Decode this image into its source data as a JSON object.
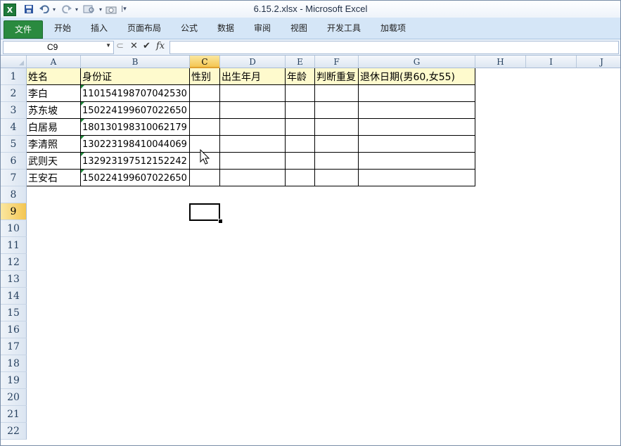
{
  "window_title": "6.15.2.xlsx  -  Microsoft Excel",
  "app_icon_letter": "X",
  "ribbon_tabs": [
    "文件",
    "开始",
    "插入",
    "页面布局",
    "公式",
    "数据",
    "审阅",
    "视图",
    "开发工具",
    "加载项"
  ],
  "name_box": "C9",
  "formula_icons": {
    "cancel": "✕",
    "enter": "✔",
    "fx": "fx"
  },
  "formula_value": "",
  "columns": [
    "A",
    "B",
    "C",
    "D",
    "E",
    "F",
    "G",
    "H",
    "I",
    "J"
  ],
  "rows": [
    "1",
    "2",
    "3",
    "4",
    "5",
    "6",
    "7",
    "8",
    "9",
    "10",
    "11",
    "12",
    "13",
    "14",
    "15",
    "16",
    "17",
    "18",
    "19",
    "20",
    "21",
    "22"
  ],
  "selected_column": "C",
  "selected_row": "9",
  "header_row": [
    "姓名",
    "身份证",
    "性别",
    "出生年月",
    "年龄",
    "判断重复",
    "退休日期(男60,女55)"
  ],
  "data_rows": [
    [
      "李白",
      "110154198707042530"
    ],
    [
      "苏东坡",
      "150224199607022650"
    ],
    [
      "白居易",
      "180130198310062179"
    ],
    [
      "李清照",
      "130223198410044069"
    ],
    [
      "武则天",
      "132923197512152242"
    ],
    [
      "王安石",
      "150224199607022650"
    ]
  ],
  "colors": {
    "header_fill": "#fefacd",
    "file_tab": "#2a8a3f",
    "tab_bar": "#d5e6f7",
    "selected_header": "#f4c652"
  },
  "icons": [
    "excel-app-icon",
    "save-icon",
    "undo-icon",
    "redo-icon",
    "preview-icon",
    "camera-icon",
    "customize-icon",
    "dropdown-icon",
    "cancel-icon",
    "enter-icon",
    "fx-icon",
    "mouse-cursor-icon"
  ]
}
